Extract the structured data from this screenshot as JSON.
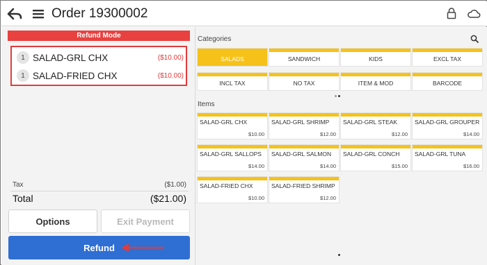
{
  "header": {
    "title": "Order 19300002",
    "icons": [
      "back-arrow-icon",
      "hamburger-menu-icon",
      "lock-icon",
      "cloud-icon"
    ]
  },
  "left_panel": {
    "mode_banner": "Refund Mode",
    "order_lines": [
      {
        "qty": "1",
        "name": "SALAD-GRL CHX",
        "price": "($10.00)"
      },
      {
        "qty": "1",
        "name": "SALAD-FRIED CHX",
        "price": "($10.00)"
      }
    ],
    "tax_label": "Tax",
    "tax_value": "($1.00)",
    "total_label": "Total",
    "total_value": "($21.00)",
    "options_label": "Options",
    "exit_payment_label": "Exit Payment",
    "refund_label": "Refund"
  },
  "right_panel": {
    "categories_label": "Categories",
    "items_label": "Items",
    "categories": [
      {
        "label": "SALADS",
        "selected": true
      },
      {
        "label": "SANDWICH"
      },
      {
        "label": "KIDS"
      },
      {
        "label": "EXCL TAX"
      },
      {
        "label": "INCL TAX"
      },
      {
        "label": "NO TAX"
      },
      {
        "label": "ITEM & MOD"
      },
      {
        "label": "BARCODE"
      }
    ],
    "items": [
      {
        "name": "SALAD-GRL CHX",
        "price": "$10.00"
      },
      {
        "name": "SALAD-GRL SHRIMP",
        "price": "$12.00"
      },
      {
        "name": "SALAD-GRL STEAK",
        "price": "$12.00"
      },
      {
        "name": "SALAD-GRL GROUPER",
        "price": "$14.00"
      },
      {
        "name": "SALAD-GRL SALLOPS",
        "price": "$14.00"
      },
      {
        "name": "SALAD-GRL SALMON",
        "price": "$14.00"
      },
      {
        "name": "SALAD-GRL CONCH",
        "price": "$15.00"
      },
      {
        "name": "SALAD-GRL TUNA",
        "price": "$16.00"
      },
      {
        "name": "SALAD-FRIED CHX",
        "price": "$10.00"
      },
      {
        "name": "SALAD-FRIED SHRIMP",
        "price": "$12.00"
      }
    ]
  },
  "colors": {
    "accent_yellow": "#f6c21a",
    "refund_red": "#e8413f",
    "refund_button_blue": "#2f6ed3"
  }
}
